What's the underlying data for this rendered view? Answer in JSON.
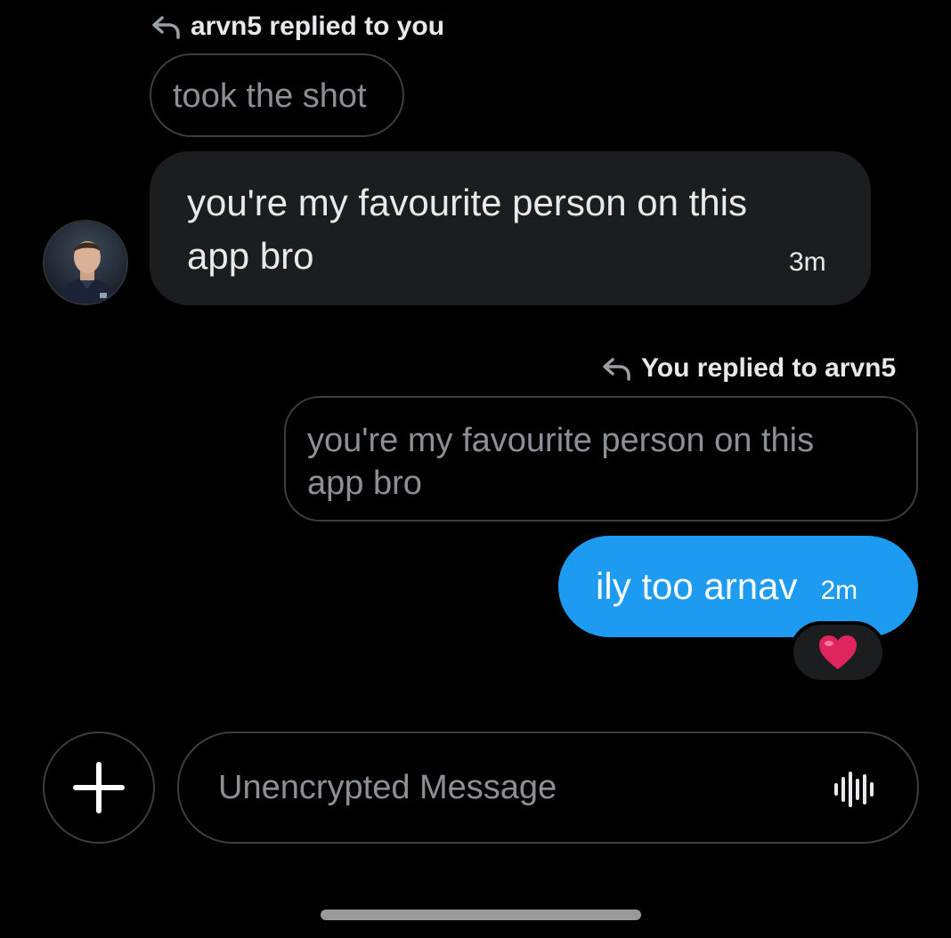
{
  "thread": {
    "incoming_reply": {
      "header_label": "arvn5 replied to you",
      "icon": "reply-arrow-icon",
      "quoted_text": "took the shot",
      "message_line_1": "you're my favourite person on this",
      "message_line_2": "app bro",
      "timestamp": "3m",
      "avatar_alt": "arvn5"
    },
    "outgoing_reply": {
      "header_label": "You replied to arvn5",
      "icon": "reply-arrow-icon",
      "quoted_line_1": "you're my favourite person on this",
      "quoted_line_2": "app bro",
      "message": "ily too arnav",
      "timestamp": "2m",
      "reaction": "❤️"
    }
  },
  "composer": {
    "plus_icon": "plus-icon",
    "placeholder": "Unencrypted Message",
    "voice_icon": "voice-waveform-icon"
  },
  "colors": {
    "background": "#000000",
    "incoming_bubble": "#1c1d20",
    "outgoing_bubble": "#1d9bf0",
    "border": "#3a3d42",
    "muted_text": "#8b9096",
    "text": "#e7e9ea",
    "heart": "#e0245e"
  }
}
